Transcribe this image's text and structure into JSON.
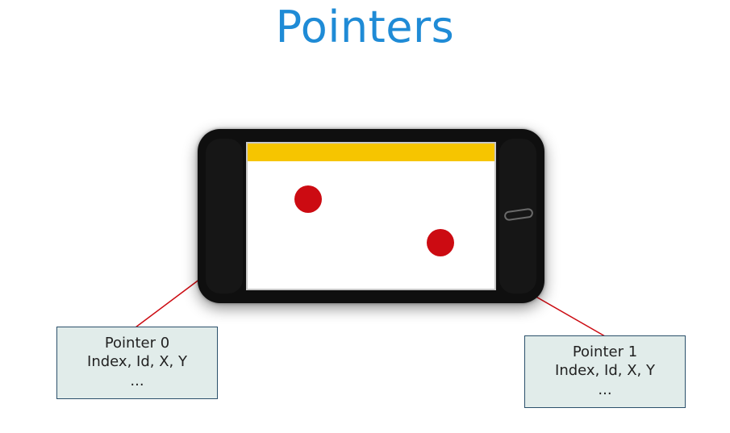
{
  "title": "Pointers",
  "pointers": [
    {
      "title": "Pointer 0",
      "fields": "Index, Id, X, Y",
      "more": "..."
    },
    {
      "title": "Pointer 1",
      "fields": "Index, Id, X, Y",
      "more": "..."
    }
  ]
}
